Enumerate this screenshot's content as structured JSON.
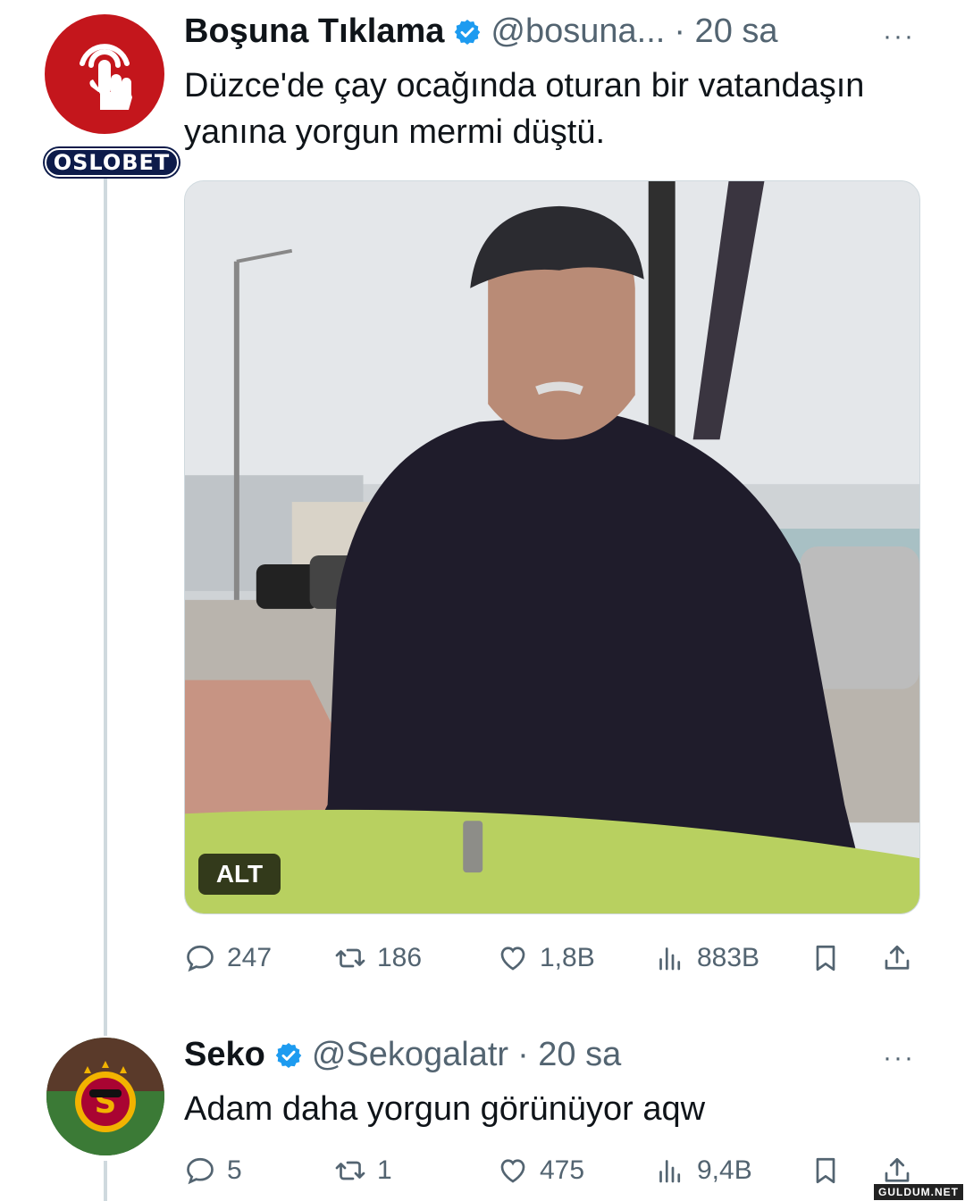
{
  "tweet1": {
    "name": "Boşuna Tıklama",
    "handle": "@bosuna...",
    "time": "· 20 sa",
    "more": "···",
    "text": "Düzce'de çay ocağında oturan bir vatandaşın yanına yorgun mermi düştü.",
    "avatar_badge": "OSLOBET",
    "media_alt_badge": "ALT",
    "stats": {
      "replies": "247",
      "retweets": "186",
      "likes": "1,8B",
      "views": "883B"
    }
  },
  "tweet2": {
    "name": "Seko",
    "handle": "@Sekogalatr",
    "time": "· 20 sa",
    "more": "···",
    "text": "Adam daha yorgun görünüyor aqw",
    "stats": {
      "replies": "5",
      "retweets": "1",
      "likes": "475",
      "views": "9,4B"
    }
  },
  "watermark": "GULDUM.NET",
  "colors": {
    "verified": "#1d9bf0",
    "muted": "#536471",
    "avatar1_bg": "#c4161c",
    "badge_bg": "#0d1b4a"
  },
  "icons": [
    "reply-icon",
    "retweet-icon",
    "like-icon",
    "views-icon",
    "bookmark-icon",
    "share-icon",
    "verified-icon",
    "more-icon"
  ]
}
